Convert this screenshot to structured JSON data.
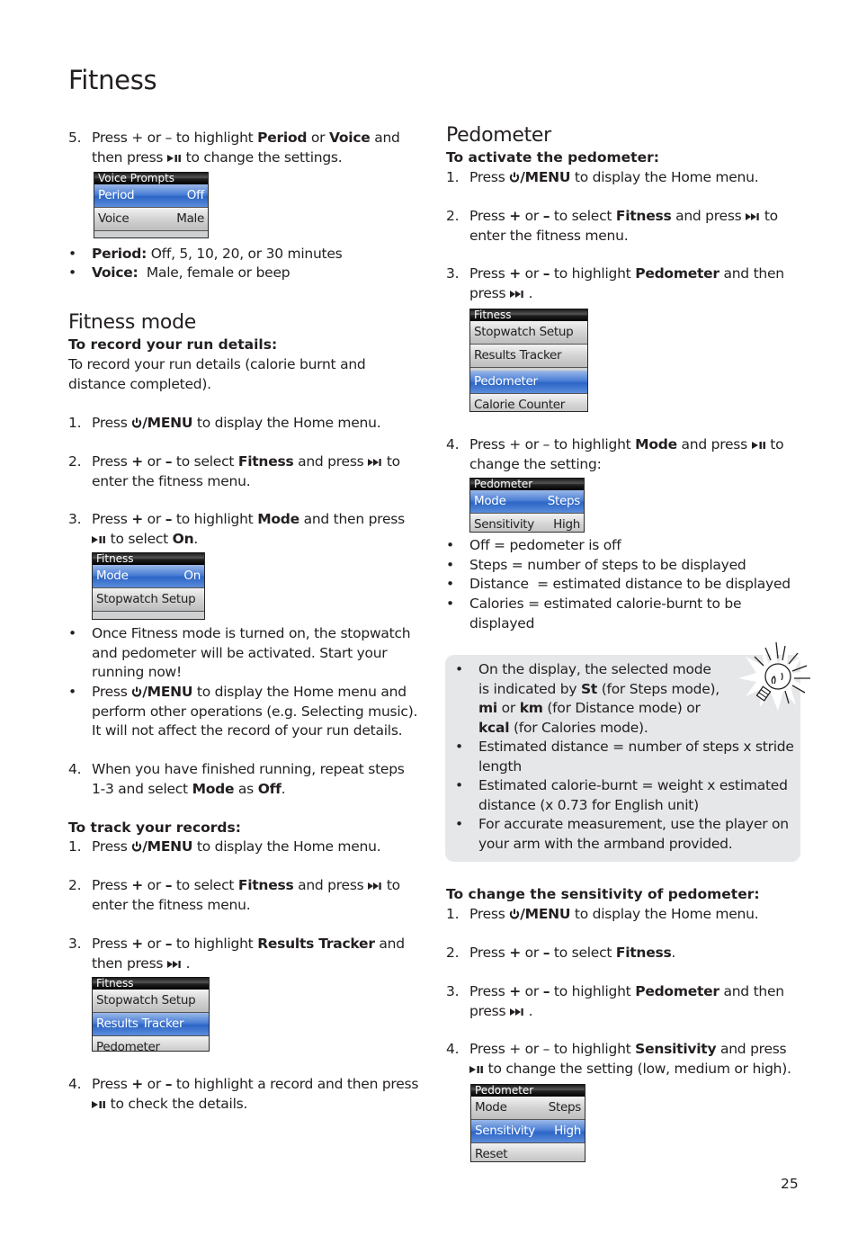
{
  "page": {
    "title": "Fitness",
    "page_number": "25"
  },
  "icons": {
    "power": "power-icon",
    "next": "skip-next-icon",
    "play_pause": "play-pause-icon",
    "tip": "lightbulb-icon"
  },
  "left": {
    "voice_step": {
      "num": "5.",
      "parts": [
        "Press + or – to highlight ",
        "Period",
        " or ",
        "Voice",
        " and then press ",
        " to change the settings."
      ]
    },
    "voice_screen": {
      "header": "Voice Prompts",
      "rows": [
        {
          "label": "Period",
          "value": "Off",
          "selected": true
        },
        {
          "label": "Voice",
          "value": "Male",
          "selected": false
        }
      ]
    },
    "voice_bullets": [
      {
        "term": "Period:",
        "text": " Off, 5, 10, 20, or 30 minutes"
      },
      {
        "term": "Voice:",
        "text": "  Male, female or beep"
      }
    ],
    "fitness_mode": {
      "heading": "Fitness mode",
      "subheading": "To record your run details:",
      "intro": "To record your run details (calorie burnt and distance completed).",
      "steps": [
        {
          "num": "1.",
          "a": "Press ",
          "bold": "/MENU",
          "b": " to display the Home menu."
        },
        {
          "num": "2.",
          "a": "Press ",
          "plus": "+",
          "or": " or ",
          "minus": "–",
          "c": " to select ",
          "bold": "Fitness",
          "d": " and press ",
          "e": " to enter the fitness menu."
        },
        {
          "num": "3.",
          "a": "Press ",
          "plus": "+",
          "or": " or ",
          "minus": "–",
          "c": " to highlight ",
          "bold": "Mode",
          "d": " and then press ",
          "e": " to select ",
          "bold2": "On",
          "f": "."
        }
      ],
      "screen": {
        "header": "Fitness",
        "rows": [
          {
            "label": "Mode",
            "value": "On",
            "selected": true
          },
          {
            "label": "Stopwatch Setup",
            "value": "",
            "selected": false
          }
        ]
      },
      "bullets": [
        {
          "text": "Once Fitness mode is turned on, the stopwatch and pedometer will be activated. Start your running now!"
        },
        {
          "a": "Press ",
          "bold": "/MENU",
          "b": " to display the Home menu and perform other operations (e.g. Selecting music). It will not affect the record of your run details."
        }
      ],
      "step4": {
        "num": "4.",
        "a": "When you have finished running, repeat steps 1-3 and select ",
        "bold": "Mode",
        "b": " as ",
        "bold2": "Off",
        "c": "."
      }
    },
    "track": {
      "subheading": "To track your records:",
      "steps": [
        {
          "num": "1.",
          "a": "Press ",
          "bold": "/MENU",
          "b": " to display the Home menu."
        },
        {
          "num": "2.",
          "a": "Press ",
          "plus": "+",
          "or": " or ",
          "minus": "–",
          "c": " to select ",
          "bold": "Fitness",
          "d": " and press ",
          "e": " to enter the fitness menu."
        },
        {
          "num": "3.",
          "a": "Press ",
          "plus": "+",
          "or": " or ",
          "minus": "–",
          "c": " to highlight ",
          "bold": "Results Tracker",
          "d": " and then press ",
          "e": " ."
        }
      ],
      "screen": {
        "header": "Fitness",
        "rows": [
          {
            "label": "Stopwatch Setup",
            "value": "",
            "selected": false
          },
          {
            "label": "Results Tracker",
            "value": "",
            "selected": true
          },
          {
            "label": "Pedometer",
            "value": "",
            "selected": false
          }
        ]
      },
      "step4": {
        "num": "4.",
        "a": "Press ",
        "plus": "+",
        "or": " or ",
        "minus": "–",
        "c": " to highlight a record and then press ",
        "d": " to check the details."
      }
    }
  },
  "right": {
    "heading": "Pedometer",
    "activate": {
      "subheading": "To activate the pedometer:",
      "steps": [
        {
          "num": "1.",
          "a": "Press ",
          "bold": "/MENU",
          "b": " to display the Home menu."
        },
        {
          "num": "2.",
          "a": "Press ",
          "plus": "+",
          "or": " or ",
          "minus": "–",
          "c": " to select ",
          "bold": "Fitness",
          "d": " and press ",
          "e": " to enter the fitness menu."
        },
        {
          "num": "3.",
          "a": "Press ",
          "plus": "+",
          "or": " or ",
          "minus": "–",
          "c": " to highlight ",
          "bold": "Pedometer",
          "d": " and then press ",
          "e": " ."
        }
      ],
      "screen1": {
        "header": "Fitness",
        "rows": [
          {
            "label": "Stopwatch Setup",
            "value": "",
            "selected": false
          },
          {
            "label": "Results Tracker",
            "value": "",
            "selected": false
          },
          {
            "label": "Pedometer",
            "value": "",
            "selected": true
          },
          {
            "label": "Calorie Counter",
            "value": "",
            "selected": false
          }
        ]
      },
      "step4": {
        "num": "4.",
        "a": "Press + or – to highlight ",
        "bold": "Mode",
        "b": " and press ",
        "c": " to change the setting:"
      },
      "screen2": {
        "header": "Pedometer",
        "rows": [
          {
            "label": "Mode",
            "value": "Steps",
            "selected": true
          },
          {
            "label": "Sensitivity",
            "value": "High",
            "selected": false
          }
        ]
      },
      "bullets": [
        "Off = pedometer is off",
        "Steps = number of steps to be displayed",
        "Distance  = estimated distance to be displayed",
        "Calories = estimated calorie-burnt to be displayed"
      ]
    },
    "tip": {
      "bullets": [
        {
          "a": "On the display, the selected mode is indicated by ",
          "b1": "St",
          "c": " (for Steps mode), ",
          "b2": "mi",
          "d": " or ",
          "b3": "km",
          "e": " (for Distance mode) or ",
          "b4": "kcal",
          "f": " (for Calories mode)."
        },
        {
          "text": "Estimated distance = number of steps x stride length"
        },
        {
          "text": "Estimated calorie-burnt = weight x estimated distance (x 0.73 for English unit)"
        },
        {
          "text": "For accurate measurement, use the player on your arm with the armband provided."
        }
      ]
    },
    "sensitivity": {
      "subheading": "To change the sensitivity of pedometer:",
      "steps": [
        {
          "num": "1.",
          "a": "Press ",
          "bold": "/MENU",
          "b": " to display the Home menu."
        },
        {
          "num": "2.",
          "a": "Press ",
          "plus": "+",
          "or": " or ",
          "minus": "–",
          "c": " to select ",
          "bold": "Fitness",
          "d": "."
        },
        {
          "num": "3.",
          "a": "Press ",
          "plus": "+",
          "or": " or ",
          "minus": "–",
          "c": " to highlight ",
          "bold": "Pedometer",
          "d": " and then press ",
          "e": " ."
        },
        {
          "num": "4.",
          "a": "Press + or – to highlight ",
          "bold": "Sensitivity",
          "b": " and press ",
          "c": " to change the setting (low, medium or high)."
        }
      ],
      "screen": {
        "header": "Pedometer",
        "rows": [
          {
            "label": "Mode",
            "value": "Steps",
            "selected": false
          },
          {
            "label": "Sensitivity",
            "value": "High",
            "selected": true
          },
          {
            "label": "Reset",
            "value": "",
            "selected": false
          }
        ]
      }
    }
  }
}
